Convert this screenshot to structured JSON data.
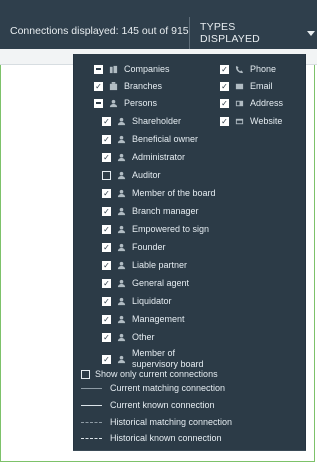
{
  "header": {
    "connections_text": "Connections displayed: 145 out of 915",
    "types_button": "TYPES DISPLAYED"
  },
  "dropdown": {
    "left_column": [
      {
        "label": "Companies",
        "state": "partial",
        "icon": "building-icon"
      },
      {
        "label": "Branches",
        "state": "checked",
        "icon": "branches-icon"
      },
      {
        "label": "Persons",
        "state": "partial",
        "icon": "person-icon"
      },
      {
        "label": "Shareholder",
        "state": "checked",
        "icon": "person-icon"
      },
      {
        "label": "Beneficial owner",
        "state": "checked",
        "icon": "person-icon"
      },
      {
        "label": "Administrator",
        "state": "checked",
        "icon": "person-icon"
      },
      {
        "label": "Auditor",
        "state": "unchecked",
        "icon": "person-icon"
      },
      {
        "label": "Member of the board",
        "state": "checked",
        "icon": "person-icon"
      },
      {
        "label": "Branch manager",
        "state": "checked",
        "icon": "person-icon"
      },
      {
        "label": "Empowered to sign",
        "state": "checked",
        "icon": "person-icon"
      },
      {
        "label": "Founder",
        "state": "checked",
        "icon": "person-icon"
      },
      {
        "label": "Liable partner",
        "state": "checked",
        "icon": "person-icon"
      },
      {
        "label": "General agent",
        "state": "checked",
        "icon": "person-icon"
      },
      {
        "label": "Liquidator",
        "state": "checked",
        "icon": "person-icon"
      },
      {
        "label": "Management",
        "state": "checked",
        "icon": "person-icon"
      },
      {
        "label": "Other",
        "state": "checked",
        "icon": "person-icon"
      },
      {
        "label": "Member of supervisory board",
        "state": "checked",
        "icon": "person-icon"
      }
    ],
    "right_column": [
      {
        "label": "Phone",
        "state": "checked",
        "icon": "phone-icon"
      },
      {
        "label": "Email",
        "state": "checked",
        "icon": "email-icon"
      },
      {
        "label": "Address",
        "state": "checked",
        "icon": "address-icon"
      },
      {
        "label": "Website",
        "state": "checked",
        "icon": "website-icon"
      }
    ],
    "current_only": {
      "label": "Show only current connections",
      "state": "unchecked"
    },
    "legend": [
      {
        "label": "Current matching connection",
        "style": "solid-light"
      },
      {
        "label": "Current known connection",
        "style": "solid-white"
      },
      {
        "label": "Historical matching connection",
        "style": "dashed-thin"
      },
      {
        "label": "Historical known connection",
        "style": "dashed-white"
      }
    ]
  }
}
